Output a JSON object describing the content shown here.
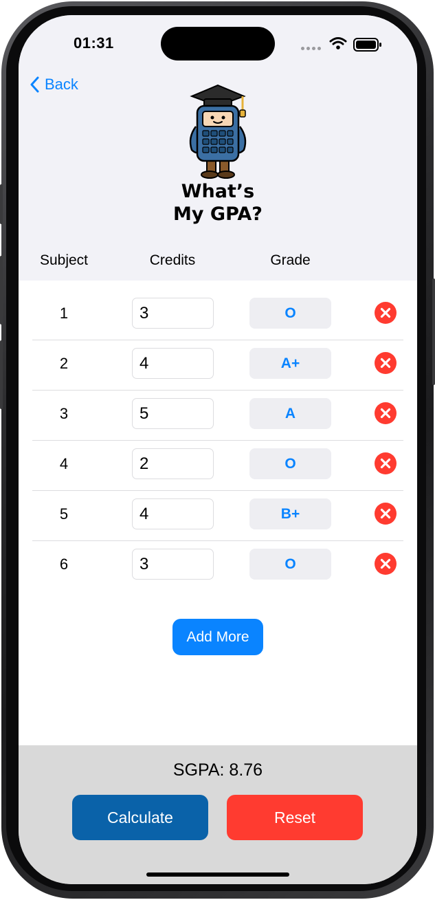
{
  "status_bar": {
    "time": "01:31"
  },
  "nav": {
    "back_label": "Back"
  },
  "app": {
    "title_line1": "What’s",
    "title_line2": "My GPA?"
  },
  "table": {
    "headers": {
      "subject": "Subject",
      "credits": "Credits",
      "grade": "Grade"
    },
    "rows": [
      {
        "subject": "1",
        "credits": "3",
        "grade": "O"
      },
      {
        "subject": "2",
        "credits": "4",
        "grade": "A+"
      },
      {
        "subject": "3",
        "credits": "5",
        "grade": "A"
      },
      {
        "subject": "4",
        "credits": "2",
        "grade": "O"
      },
      {
        "subject": "5",
        "credits": "4",
        "grade": "B+"
      },
      {
        "subject": "6",
        "credits": "3",
        "grade": "O"
      }
    ]
  },
  "actions": {
    "add_more_label": "Add More",
    "calculate_label": "Calculate",
    "reset_label": "Reset"
  },
  "result": {
    "sgpa_text": "SGPA: 8.76"
  },
  "colors": {
    "accent": "#0a84ff",
    "calculate": "#0a62a9",
    "reset": "#ff3b30",
    "header_bg": "#f2f2f7",
    "footer_bg": "#d9d9d9"
  },
  "icons": {
    "back": "chevron-left-icon",
    "delete": "xmark-circle-fill-icon",
    "wifi": "wifi-icon",
    "battery": "battery-icon",
    "mascot": "calculator-graduate-mascot"
  }
}
